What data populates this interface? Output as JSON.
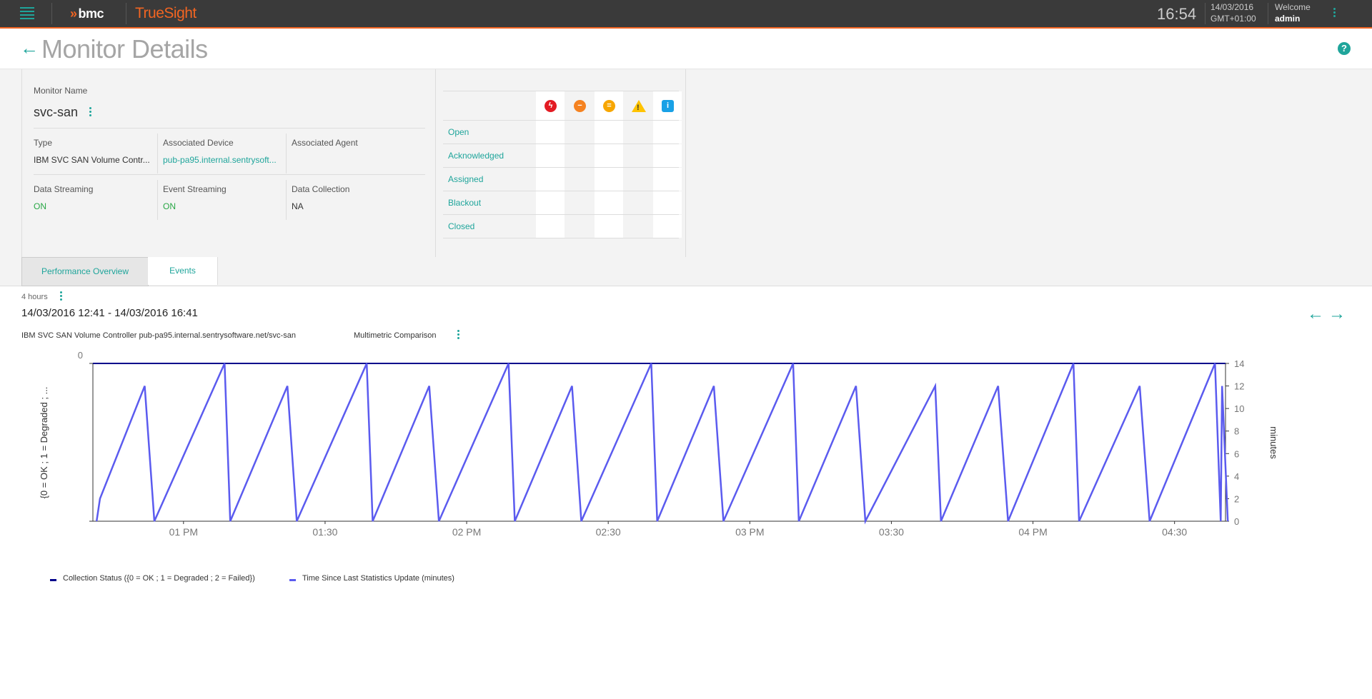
{
  "topbar": {
    "menu_icon": "hamburger-icon",
    "brand": "bmc",
    "product": "TrueSight",
    "time": "16:54",
    "date": "14/03/2016",
    "timezone": "GMT+01:00",
    "welcome_label": "Welcome",
    "user": "admin",
    "accent_color": "#f26522",
    "teal_color": "#1fa59b"
  },
  "header": {
    "title": "Monitor Details",
    "back_icon": "back-arrow-icon",
    "help_icon": "help-icon",
    "help_glyph": "?"
  },
  "monitor": {
    "name_label": "Monitor Name",
    "name": "svc-san",
    "fields": {
      "type_label": "Type",
      "type": "IBM SVC SAN Volume Contr...",
      "device_label": "Associated Device",
      "device": "pub-pa95.internal.sentrysoft...",
      "agent_label": "Associated Agent",
      "agent": "",
      "data_streaming_label": "Data Streaming",
      "data_streaming": "ON",
      "event_streaming_label": "Event Streaming",
      "event_streaming": "ON",
      "data_collection_label": "Data Collection",
      "data_collection": "NA"
    }
  },
  "events": {
    "severities": [
      {
        "name": "critical-icon",
        "color": "#e31b23",
        "glyph": "ϟ"
      },
      {
        "name": "major-icon",
        "color": "#f58220",
        "glyph": "−"
      },
      {
        "name": "minor-icon",
        "color": "#f7a600",
        "glyph": "="
      },
      {
        "name": "warning-icon",
        "color": "#ffc300",
        "glyph": "!"
      },
      {
        "name": "info-icon",
        "color": "#19a1e6",
        "glyph": "i"
      }
    ],
    "rows": [
      {
        "label": "Open"
      },
      {
        "label": "Acknowledged"
      },
      {
        "label": "Assigned"
      },
      {
        "label": "Blackout"
      },
      {
        "label": "Closed"
      }
    ]
  },
  "tabs": [
    {
      "label": "Performance Overview",
      "active": true
    },
    {
      "label": "Events",
      "active": false
    }
  ],
  "perf": {
    "range": "4 hours",
    "date_range": "14/03/2016 12:41 - 14/03/2016 16:41",
    "source": "IBM SVC SAN Volume Controller pub-pa95.internal.sentrysoftware.net/svc-san",
    "mode": "Multimetric Comparison",
    "prev_icon": "arrow-left-icon",
    "next_icon": "arrow-right-icon"
  },
  "chart_data": {
    "type": "line",
    "title": "",
    "x_ticks": [
      "01 PM",
      "01:30",
      "02 PM",
      "02:30",
      "03 PM",
      "03:30",
      "04 PM",
      "04:30"
    ],
    "x_range_min": [
      12.68,
      16.68
    ],
    "left_axis": {
      "label": "{0 = OK ; 1 = Degraded ; ...",
      "ticks": [
        "0"
      ],
      "ylim": [
        0,
        0
      ]
    },
    "right_axis": {
      "label": "minutes",
      "ticks": [
        0,
        2,
        4,
        6,
        8,
        10,
        12,
        14
      ],
      "ylim": [
        0,
        14
      ]
    },
    "grid": false,
    "legend_position": "bottom-left",
    "series": [
      {
        "name": "Collection Status ({0 = OK ; 1 = Degraded ; 2 = Failed})",
        "color": "#00008b",
        "axis": "left",
        "x_hours": [
          12.68,
          16.68
        ],
        "y": [
          0,
          0
        ]
      },
      {
        "name": "Time Since Last Statistics Update (minutes)",
        "color": "#5b5bef",
        "axis": "right",
        "x_hours": [
          12.693,
          12.705,
          12.863,
          12.897,
          13.145,
          13.165,
          13.367,
          13.4,
          13.647,
          13.668,
          13.868,
          13.902,
          14.148,
          14.17,
          14.372,
          14.405,
          14.652,
          14.673,
          14.873,
          14.907,
          15.153,
          15.173,
          15.375,
          15.408,
          15.655,
          15.675,
          15.877,
          15.912,
          16.143,
          16.163,
          16.377,
          16.412,
          16.643,
          16.663,
          16.668,
          16.688
        ],
        "y": [
          0,
          2,
          12,
          0,
          14,
          0,
          12,
          0,
          14,
          0,
          12,
          0,
          14,
          0,
          12,
          0,
          14,
          0,
          12,
          0,
          14,
          0,
          12,
          0,
          12,
          0,
          12,
          0,
          14,
          0,
          12,
          0,
          14,
          0,
          12,
          0
        ]
      }
    ]
  }
}
